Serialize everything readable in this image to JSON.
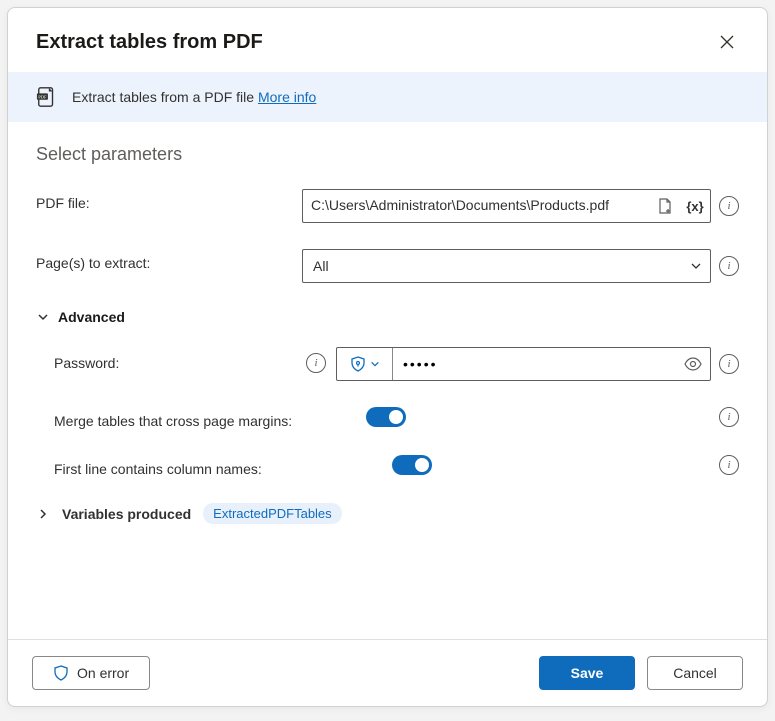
{
  "header": {
    "title": "Extract tables from PDF"
  },
  "banner": {
    "text": "Extract tables from a PDF file",
    "more_info": "More info"
  },
  "section_title": "Select parameters",
  "params": {
    "pdf_file_label": "PDF file:",
    "pdf_file_value": "C:\\Users\\Administrator\\Documents\\Products.pdf",
    "pages_label": "Page(s) to extract:",
    "pages_value": "All",
    "advanced_label": "Advanced",
    "password_label": "Password:",
    "password_value": "•••••",
    "merge_label": "Merge tables that cross page margins:",
    "merge_value": true,
    "firstline_label": "First line contains column names:",
    "firstline_value": true
  },
  "variables": {
    "label": "Variables produced",
    "chip": "ExtractedPDFTables"
  },
  "footer": {
    "on_error": "On error",
    "save": "Save",
    "cancel": "Cancel"
  }
}
